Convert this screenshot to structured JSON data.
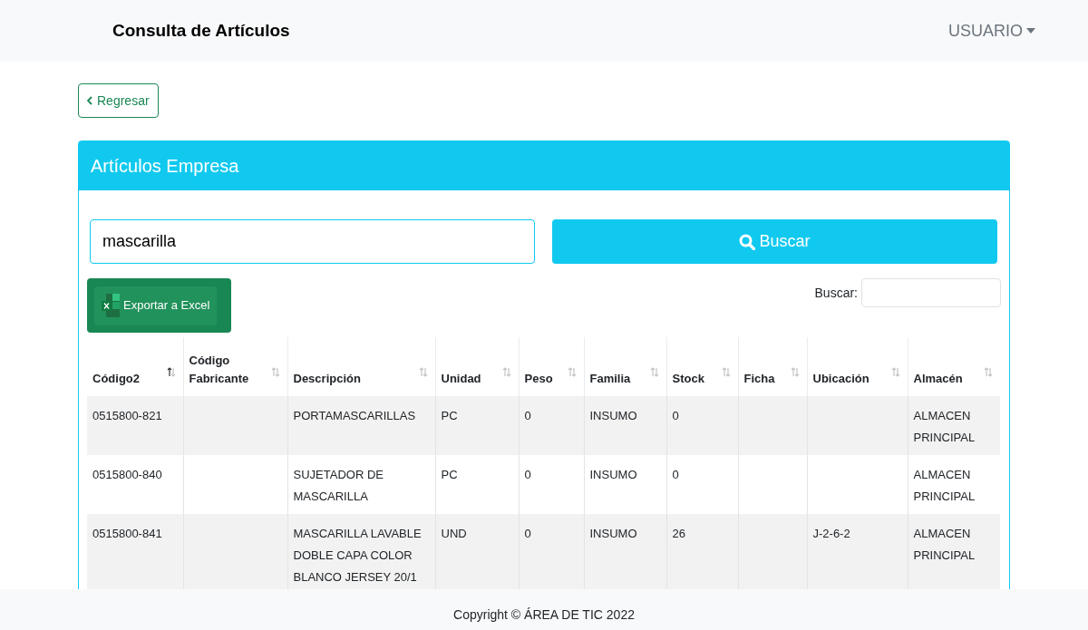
{
  "navbar": {
    "title": "Consulta de Artículos",
    "user_menu": "USUARIO"
  },
  "back_button": "Regresar",
  "card": {
    "title": "Artículos Empresa",
    "search_field": {
      "value": "mascarilla"
    },
    "search_button": "Buscar",
    "export_button": "Exportar a Excel",
    "filter": {
      "label": "Buscar:"
    },
    "table": {
      "columns": [
        {
          "label": "Código2",
          "sorted": true
        },
        {
          "label": "Código Fabricante",
          "sorted": false
        },
        {
          "label": "Descripción",
          "sorted": false
        },
        {
          "label": "Unidad",
          "sorted": false
        },
        {
          "label": "Peso",
          "sorted": false
        },
        {
          "label": "Familia",
          "sorted": false
        },
        {
          "label": "Stock",
          "sorted": false
        },
        {
          "label": "Ficha",
          "sorted": false
        },
        {
          "label": "Ubicación",
          "sorted": false
        },
        {
          "label": "Almacén",
          "sorted": false
        }
      ],
      "rows": [
        [
          "0515800-821",
          "",
          "PORTAMASCARILLAS",
          "PC",
          "0",
          "INSUMO",
          "0",
          "",
          "",
          "ALMACEN PRINCIPAL"
        ],
        [
          "0515800-840",
          "",
          "SUJETADOR DE MASCARILLA",
          "PC",
          "0",
          "INSUMO",
          "0",
          "",
          "",
          "ALMACEN PRINCIPAL"
        ],
        [
          "0515800-841",
          "",
          "MASCARILLA LAVABLE DOBLE CAPA COLOR BLANCO JERSEY 20/1",
          "UND",
          "0",
          "INSUMO",
          "26",
          "",
          "J-2-6-2",
          "ALMACEN PRINCIPAL"
        ]
      ]
    }
  },
  "footer": "Copyright © ÁREA DE TIC 2022"
}
